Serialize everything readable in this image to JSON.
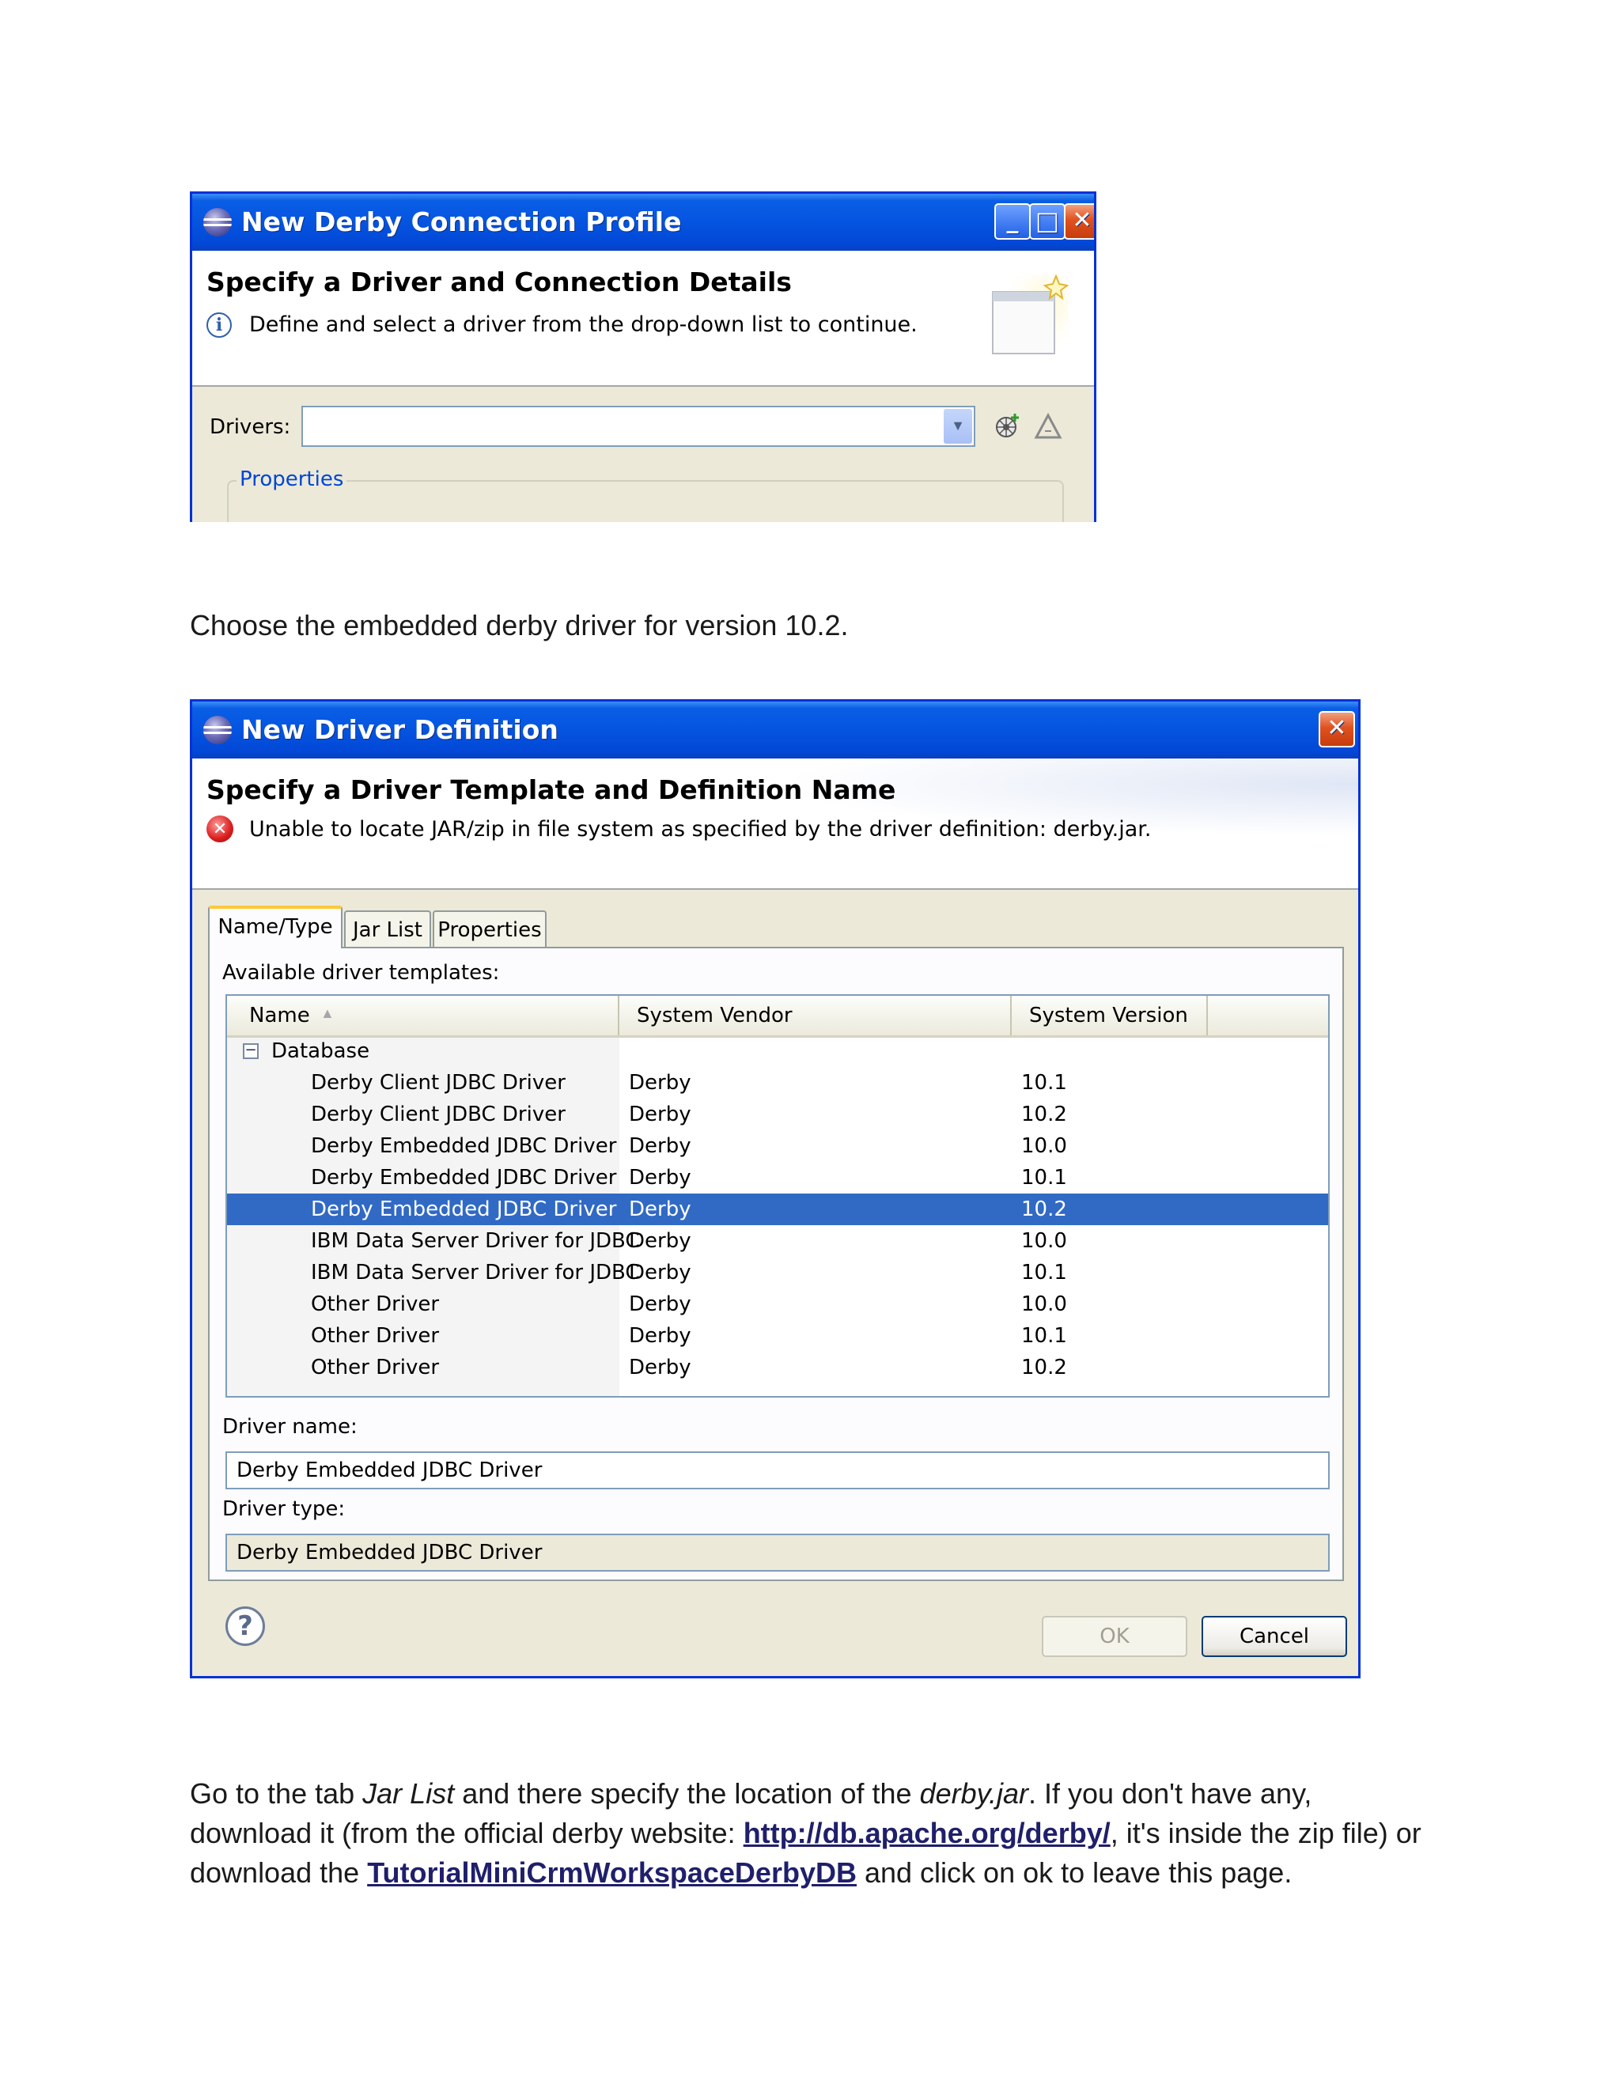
{
  "dialog1": {
    "title": "New Derby Connection Profile",
    "minimize_glyph": "_",
    "maximize_glyph": "□",
    "close_glyph": "✕",
    "header_title": "Specify a Driver and Connection Details",
    "info_icon": "info-icon",
    "info_glyph": "i",
    "message": "Define and select a driver from the drop-down list to continue.",
    "drivers_label": "Drivers:",
    "drivers_value": "",
    "new_driver_icon": "new-driver-icon",
    "edit_driver_icon": "edit-driver-icon",
    "properties_legend": "Properties"
  },
  "para1": "Choose the embedded derby driver for version 10.2.",
  "dialog2": {
    "title": "New Driver Definition",
    "close_glyph": "✕",
    "header_title": "Specify a Driver Template and Definition Name",
    "error_icon": "error-icon",
    "error_glyph": "✕",
    "message": "Unable to locate JAR/zip in file system as specified by the driver definition: derby.jar.",
    "tabs": [
      {
        "label": "Name/Type",
        "active": true
      },
      {
        "label": "Jar List",
        "active": false
      },
      {
        "label": "Properties",
        "active": false
      }
    ],
    "templates_label": "Available driver templates:",
    "columns": [
      "Name",
      "System Vendor",
      "System Version"
    ],
    "sort_glyph": "▲",
    "category": "Database",
    "collapse_glyph": "−",
    "rows": [
      {
        "name": "Derby Client JDBC Driver",
        "vendor": "Derby",
        "version": "10.1",
        "selected": false
      },
      {
        "name": "Derby Client JDBC Driver",
        "vendor": "Derby",
        "version": "10.2",
        "selected": false
      },
      {
        "name": "Derby Embedded JDBC Driver",
        "vendor": "Derby",
        "version": "10.0",
        "selected": false
      },
      {
        "name": "Derby Embedded JDBC Driver",
        "vendor": "Derby",
        "version": "10.1",
        "selected": false
      },
      {
        "name": "Derby Embedded JDBC Driver",
        "vendor": "Derby",
        "version": "10.2",
        "selected": true
      },
      {
        "name": "IBM Data Server Driver for JDBC",
        "vendor": "Derby",
        "version": "10.0",
        "selected": false
      },
      {
        "name": "IBM Data Server Driver for JDBC",
        "vendor": "Derby",
        "version": "10.1",
        "selected": false
      },
      {
        "name": "Other Driver",
        "vendor": "Derby",
        "version": "10.0",
        "selected": false
      },
      {
        "name": "Other Driver",
        "vendor": "Derby",
        "version": "10.1",
        "selected": false
      },
      {
        "name": "Other Driver",
        "vendor": "Derby",
        "version": "10.2",
        "selected": false
      }
    ],
    "driver_name_label": "Driver name:",
    "driver_name_value": "Derby Embedded JDBC Driver",
    "driver_type_label": "Driver type:",
    "driver_type_value": "Derby Embedded JDBC Driver",
    "help_glyph": "?",
    "ok_label": "OK",
    "cancel_label": "Cancel"
  },
  "para2": {
    "t1": "Go to the tab ",
    "t2": "Jar List",
    "t3": " and there specify the location of the ",
    "t4": "derby.jar",
    "t5": ". If you don't have any, download it (from the official derby website: ",
    "link1": "http://db.apache.org/derby/",
    "t6": ", it's inside the zip file) or download the ",
    "link2": "TutorialMiniCrmWorkspaceDerbyDB",
    "t7": " and click on ok to leave this page."
  },
  "colors": {
    "title_blue": "#0554e0",
    "selection": "#316ac5",
    "dialog_bg": "#ece9d8",
    "link": "#1f1f6b"
  }
}
